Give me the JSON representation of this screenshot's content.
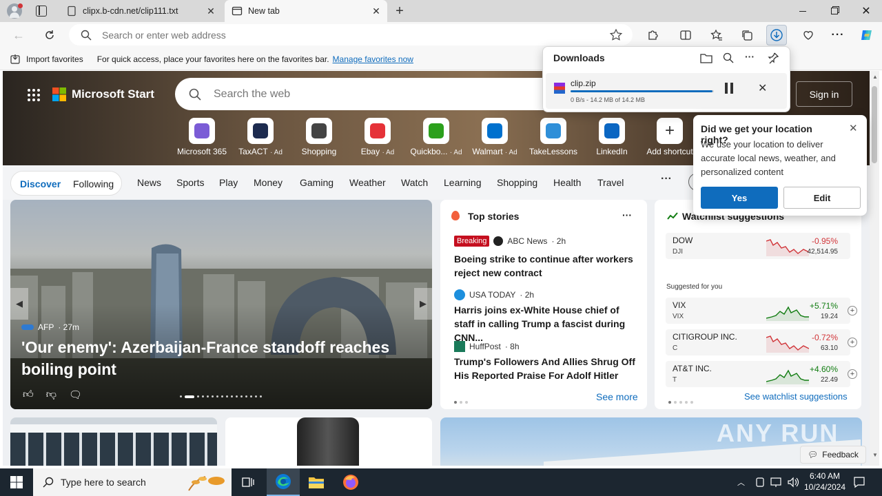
{
  "browser": {
    "tabs": [
      {
        "label": "clipx.b-cdn.net/clip111.txt",
        "active": false
      },
      {
        "label": "New tab",
        "active": true
      }
    ],
    "address_placeholder": "Search or enter web address"
  },
  "favorites_bar": {
    "import_label": "Import favorites",
    "hint": "For quick access, place your favorites here on the favorites bar.",
    "manage_link": "Manage favorites now"
  },
  "downloads": {
    "title": "Downloads",
    "file_name": "clip.zip",
    "status": "0 B/s - 14.2 MB of 14.2 MB",
    "progress": 0.99
  },
  "location_popup": {
    "title": "Did we get your location right?",
    "body": "We use your location to deliver accurate local news, weather, and personalized content",
    "yes_label": "Yes",
    "edit_label": "Edit"
  },
  "msn": {
    "brand": "Microsoft Start",
    "search_placeholder": "Search the web",
    "sign_in": "Sign in",
    "apps": [
      {
        "label": "Microsoft 365",
        "ad": "",
        "icon": "microsoft365-icon",
        "color": "#7b5cd6"
      },
      {
        "label": "TaxACT",
        "ad": "· Ad",
        "icon": "taxact-icon",
        "color": "#1d2b4f"
      },
      {
        "label": "Shopping",
        "ad": "",
        "icon": "shopping-tag-icon",
        "color": "#444444"
      },
      {
        "label": "Ebay",
        "ad": "· Ad",
        "icon": "ebay-icon",
        "color": "#e53238"
      },
      {
        "label": "Quickbo...",
        "ad": "· Ad",
        "icon": "quickbooks-icon",
        "color": "#2ca01c"
      },
      {
        "label": "Walmart",
        "ad": "· Ad",
        "icon": "walmart-icon",
        "color": "#0071ce"
      },
      {
        "label": "TakeLessons",
        "ad": "",
        "icon": "takelessons-icon",
        "color": "#2f8fd8"
      },
      {
        "label": "LinkedIn",
        "ad": "",
        "icon": "linkedin-icon",
        "color": "#0a66c2"
      },
      {
        "label": "Add shortcut",
        "ad": "",
        "icon": "plus-icon",
        "color": "#333333"
      }
    ],
    "nav_pill": {
      "discover": "Discover",
      "following": "Following"
    },
    "nav_items": [
      "News",
      "Sports",
      "Play",
      "Money",
      "Gaming",
      "Weather",
      "Watch",
      "Learning",
      "Shopping",
      "Health",
      "Travel"
    ],
    "hero_article": {
      "source": "AFP",
      "time": "· 27m",
      "headline": "'Our enemy': Azerbaijan-France standoff reaches boiling point"
    },
    "top_stories": {
      "title": "Top stories",
      "see_more": "See more",
      "items": [
        {
          "badge": "Breaking",
          "source": "ABC News",
          "time": "· 2h",
          "title": "Boeing strike to continue after workers reject new contract"
        },
        {
          "badge": "",
          "source": "USA TODAY",
          "time": "· 2h",
          "title": "Harris joins ex-White House chief of staff in calling Trump a fascist during CNN..."
        },
        {
          "badge": "",
          "source": "HuffPost",
          "time": "· 8h",
          "title": "Trump's Followers And Allies Shrug Off His Reported Praise For Adolf Hitler"
        }
      ]
    },
    "watchlist": {
      "title": "Watchlist suggestions",
      "suggested_label": "Suggested for you",
      "see_link": "See watchlist suggestions",
      "stocks": [
        {
          "name": "DOW",
          "symbol": "DJI",
          "change": "-0.95%",
          "price": "42,514.95",
          "up": false
        },
        {
          "name": "VIX",
          "symbol": "VIX",
          "change": "+5.71%",
          "price": "19.24",
          "up": true
        },
        {
          "name": "CITIGROUP INC.",
          "symbol": "C",
          "change": "-0.72%",
          "price": "63.10",
          "up": false
        },
        {
          "name": "AT&T INC.",
          "symbol": "T",
          "change": "+4.60%",
          "price": "22.49",
          "up": true
        }
      ]
    },
    "feedback": "Feedback",
    "watermark": "ANY RUN"
  },
  "taskbar": {
    "search_placeholder": "Type here to search",
    "time": "6:40 AM",
    "date": "10/24/2024"
  },
  "colors": {
    "accent": "#0f6cbd",
    "red": "#d13438",
    "green": "#107c10",
    "breaking": "#c50f1f"
  }
}
